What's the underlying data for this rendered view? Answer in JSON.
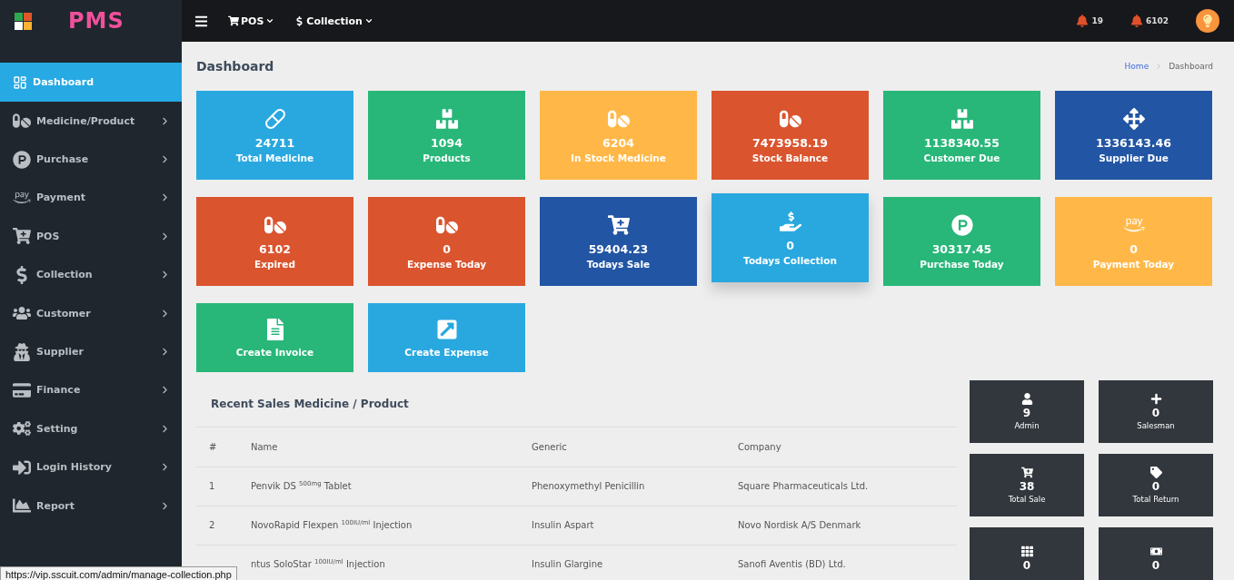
{
  "brand": {
    "logo_text": "PMS"
  },
  "topbar": {
    "menus": [
      {
        "label": "POS",
        "kind": "cart"
      },
      {
        "label": "Collection",
        "kind": "dollar"
      }
    ],
    "notifications": [
      {
        "count": "19"
      },
      {
        "count": "6102"
      }
    ]
  },
  "sidebar": {
    "items": [
      {
        "label": "Dashboard",
        "selected": true,
        "has_children": false
      },
      {
        "label": "Medicine/Product",
        "selected": false,
        "has_children": true
      },
      {
        "label": "Purchase",
        "selected": false,
        "has_children": true
      },
      {
        "label": "Payment",
        "selected": false,
        "has_children": true
      },
      {
        "label": "POS",
        "selected": false,
        "has_children": true
      },
      {
        "label": "Collection",
        "selected": false,
        "has_children": true
      },
      {
        "label": "Customer",
        "selected": false,
        "has_children": true
      },
      {
        "label": "Supplier",
        "selected": false,
        "has_children": true
      },
      {
        "label": "Finance",
        "selected": false,
        "has_children": true
      },
      {
        "label": "Setting",
        "selected": false,
        "has_children": true
      },
      {
        "label": "Login History",
        "selected": false,
        "has_children": true
      },
      {
        "label": "Report",
        "selected": false,
        "has_children": true
      }
    ]
  },
  "page": {
    "title": "Dashboard",
    "breadcrumb": [
      {
        "label": "Home",
        "link": true
      },
      {
        "label": "Dashboard",
        "link": false
      }
    ]
  },
  "cards": [
    {
      "value": "24711",
      "label": "Total Medicine",
      "color": "#29a8e0",
      "hovered": false
    },
    {
      "value": "1094",
      "label": "Products",
      "color": "#28b779",
      "hovered": false
    },
    {
      "value": "6204",
      "label": "In Stock Medicine",
      "color": "#ffb848",
      "hovered": false
    },
    {
      "value": "7473958.19",
      "label": "Stock Balance",
      "color": "#da542e",
      "hovered": false
    },
    {
      "value": "1138340.55",
      "label": "Customer Due",
      "color": "#28b779",
      "hovered": false
    },
    {
      "value": "1336143.46",
      "label": "Supplier Due",
      "color": "#2255a4",
      "hovered": false
    },
    {
      "value": "6102",
      "label": "Expired",
      "color": "#da542e",
      "hovered": false
    },
    {
      "value": "0",
      "label": "Expense Today",
      "color": "#da542e",
      "hovered": false
    },
    {
      "value": "59404.23",
      "label": "Todays Sale",
      "color": "#2255a4",
      "hovered": false
    },
    {
      "value": "0",
      "label": "Todays Collection",
      "color": "#29a8e0",
      "hovered": true
    },
    {
      "value": "30317.45",
      "label": "Purchase Today",
      "color": "#28b779",
      "hovered": false
    },
    {
      "value": "0",
      "label": "Payment Today",
      "color": "#ffb848",
      "hovered": false
    },
    {
      "label": "Create Invoice",
      "color": "#28b779",
      "hovered": false
    },
    {
      "label": "Create Expense",
      "color": "#29a8e0",
      "hovered": false
    }
  ],
  "recent_sales": {
    "title": "Recent Sales Medicine / Product",
    "columns": [
      "#",
      "Name",
      "Generic",
      "Company"
    ],
    "rows": [
      [
        "1",
        "Penvik DS $^{500mg}$ Tablet",
        "Phenoxymethyl Penicillin",
        "Square Pharmaceuticals Ltd."
      ],
      [
        "2",
        "NovoRapid Flexpen $^{100IU/ml}$ Injection",
        "Insulin Aspart",
        "Novo Nordisk A/S Denmark"
      ],
      [
        null,
        "ntus SoloStar $^{100IU/ml}$ Injection",
        "Insulin Glargine",
        "Sanofi Aventis (BD) Ltd."
      ]
    ]
  },
  "stats": [
    {
      "value": "9",
      "label": "Admin"
    },
    {
      "value": "0",
      "label": "Salesman"
    },
    {
      "value": "38",
      "label": "Total Sale"
    },
    {
      "value": "0",
      "label": "Total Return"
    },
    {
      "value": "0"
    },
    {
      "value": "0"
    }
  ],
  "status_url": "https://vip.sscuit.com/admin/manage-collection.php"
}
